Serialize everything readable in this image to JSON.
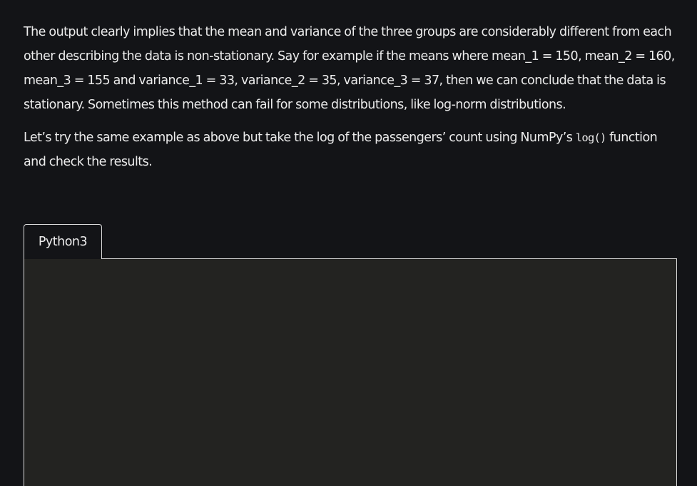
{
  "article": {
    "paragraph_1": "The output clearly implies that the mean and variance of the three groups are considerably different from each other describing the data is non-stationary. Say for example if the means where mean_1 = 150, mean_2 = 160, mean_3 = 155 and variance_1 = 33, variance_2 = 35, variance_3 = 37, then we can conclude that the data is stationary. Sometimes this method can fail for some distributions, like log-norm distributions.",
    "paragraph_2_before": "Let’s try the same example as above but take the log of the passengers’ count using NumPy’s ",
    "paragraph_2_code": "log()",
    "paragraph_2_after": " function and check the results."
  },
  "code_block": {
    "language_tab": "Python3",
    "code": ""
  },
  "colors": {
    "page_background": "#131417",
    "code_background": "#232321",
    "text": "#ececec",
    "border": "#dcdcdc"
  }
}
